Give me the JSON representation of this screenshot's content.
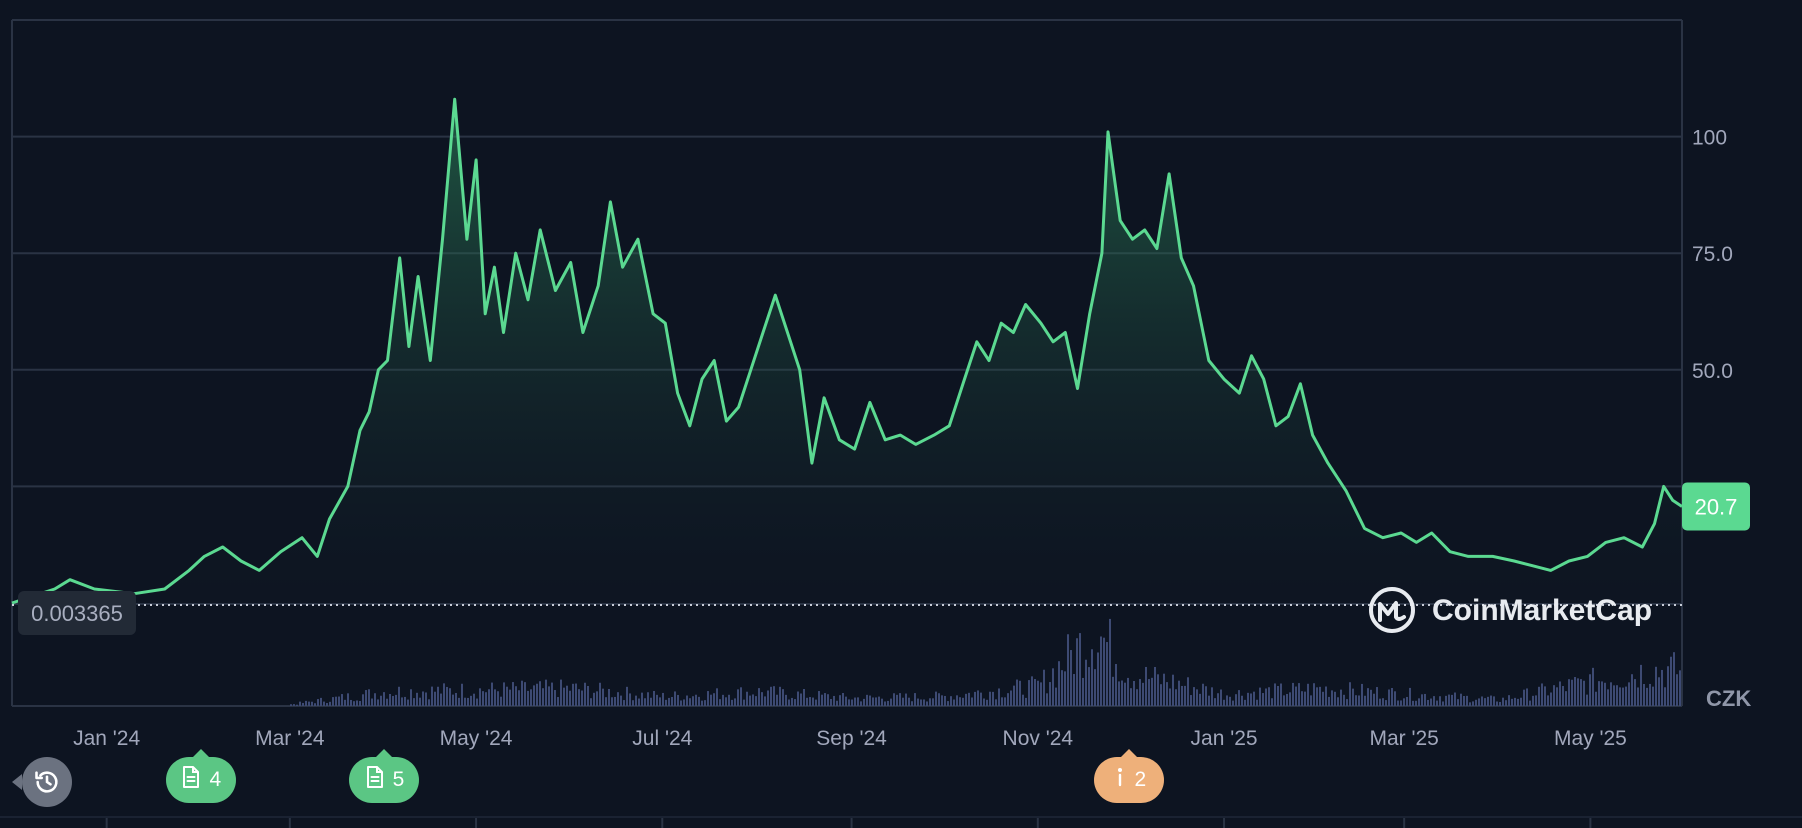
{
  "chart_data": {
    "type": "area",
    "x_range": [
      "2023-12-01",
      "2025-05-31"
    ],
    "ylim": [
      0,
      125
    ],
    "y_ticks": [
      {
        "value": 100,
        "label": "100"
      },
      {
        "value": 75,
        "label": "75.0"
      },
      {
        "value": 50,
        "label": "50.0"
      },
      {
        "value": 25,
        "label": ""
      }
    ],
    "x_ticks": [
      {
        "date": "2024-01-01",
        "label": "Jan '24"
      },
      {
        "date": "2024-03-01",
        "label": "Mar '24"
      },
      {
        "date": "2024-05-01",
        "label": "May '24"
      },
      {
        "date": "2024-07-01",
        "label": "Jul '24"
      },
      {
        "date": "2024-09-01",
        "label": "Sep '24"
      },
      {
        "date": "2024-11-01",
        "label": "Nov '24"
      },
      {
        "date": "2025-01-01",
        "label": "Jan '25"
      },
      {
        "date": "2025-03-01",
        "label": "Mar '25"
      },
      {
        "date": "2025-05-01",
        "label": "May '25"
      }
    ],
    "series": [
      {
        "line_color": "#5bd991",
        "points": [
          [
            "2023-12-01",
            0.003365
          ],
          [
            "2023-12-15",
            3
          ],
          [
            "2023-12-20",
            5
          ],
          [
            "2023-12-28",
            3
          ],
          [
            "2024-01-10",
            2
          ],
          [
            "2024-01-20",
            3
          ],
          [
            "2024-01-28",
            7
          ],
          [
            "2024-02-02",
            10
          ],
          [
            "2024-02-08",
            12
          ],
          [
            "2024-02-14",
            9
          ],
          [
            "2024-02-20",
            7
          ],
          [
            "2024-02-27",
            11
          ],
          [
            "2024-03-05",
            14
          ],
          [
            "2024-03-10",
            10
          ],
          [
            "2024-03-14",
            18
          ],
          [
            "2024-03-20",
            25
          ],
          [
            "2024-03-24",
            37
          ],
          [
            "2024-03-27",
            41
          ],
          [
            "2024-03-30",
            50
          ],
          [
            "2024-04-02",
            52
          ],
          [
            "2024-04-06",
            74
          ],
          [
            "2024-04-09",
            55
          ],
          [
            "2024-04-12",
            70
          ],
          [
            "2024-04-16",
            52
          ],
          [
            "2024-04-20",
            78
          ],
          [
            "2024-04-24",
            108
          ],
          [
            "2024-04-28",
            78
          ],
          [
            "2024-05-01",
            95
          ],
          [
            "2024-05-04",
            62
          ],
          [
            "2024-05-07",
            72
          ],
          [
            "2024-05-10",
            58
          ],
          [
            "2024-05-14",
            75
          ],
          [
            "2024-05-18",
            65
          ],
          [
            "2024-05-22",
            80
          ],
          [
            "2024-05-27",
            67
          ],
          [
            "2024-06-01",
            73
          ],
          [
            "2024-06-05",
            58
          ],
          [
            "2024-06-10",
            68
          ],
          [
            "2024-06-14",
            86
          ],
          [
            "2024-06-18",
            72
          ],
          [
            "2024-06-23",
            78
          ],
          [
            "2024-06-28",
            62
          ],
          [
            "2024-07-02",
            60
          ],
          [
            "2024-07-06",
            45
          ],
          [
            "2024-07-10",
            38
          ],
          [
            "2024-07-14",
            48
          ],
          [
            "2024-07-18",
            52
          ],
          [
            "2024-07-22",
            39
          ],
          [
            "2024-07-26",
            42
          ],
          [
            "2024-07-30",
            50
          ],
          [
            "2024-08-03",
            58
          ],
          [
            "2024-08-07",
            66
          ],
          [
            "2024-08-11",
            58
          ],
          [
            "2024-08-15",
            50
          ],
          [
            "2024-08-19",
            30
          ],
          [
            "2024-08-23",
            44
          ],
          [
            "2024-08-28",
            35
          ],
          [
            "2024-09-02",
            33
          ],
          [
            "2024-09-07",
            43
          ],
          [
            "2024-09-12",
            35
          ],
          [
            "2024-09-17",
            36
          ],
          [
            "2024-09-22",
            34
          ],
          [
            "2024-09-28",
            36
          ],
          [
            "2024-10-03",
            38
          ],
          [
            "2024-10-08",
            48
          ],
          [
            "2024-10-12",
            56
          ],
          [
            "2024-10-16",
            52
          ],
          [
            "2024-10-20",
            60
          ],
          [
            "2024-10-24",
            58
          ],
          [
            "2024-10-28",
            64
          ],
          [
            "2024-11-02",
            60
          ],
          [
            "2024-11-06",
            56
          ],
          [
            "2024-11-10",
            58
          ],
          [
            "2024-11-14",
            46
          ],
          [
            "2024-11-18",
            62
          ],
          [
            "2024-11-22",
            75
          ],
          [
            "2024-11-24",
            101
          ],
          [
            "2024-11-28",
            82
          ],
          [
            "2024-12-02",
            78
          ],
          [
            "2024-12-06",
            80
          ],
          [
            "2024-12-10",
            76
          ],
          [
            "2024-12-14",
            92
          ],
          [
            "2024-12-18",
            74
          ],
          [
            "2024-12-22",
            68
          ],
          [
            "2024-12-27",
            52
          ],
          [
            "2025-01-01",
            48
          ],
          [
            "2025-01-06",
            45
          ],
          [
            "2025-01-10",
            53
          ],
          [
            "2025-01-14",
            48
          ],
          [
            "2025-01-18",
            38
          ],
          [
            "2025-01-22",
            40
          ],
          [
            "2025-01-26",
            47
          ],
          [
            "2025-01-30",
            36
          ],
          [
            "2025-02-04",
            30
          ],
          [
            "2025-02-10",
            24
          ],
          [
            "2025-02-16",
            16
          ],
          [
            "2025-02-22",
            14
          ],
          [
            "2025-02-28",
            15
          ],
          [
            "2025-03-05",
            13
          ],
          [
            "2025-03-10",
            15
          ],
          [
            "2025-03-16",
            11
          ],
          [
            "2025-03-22",
            10
          ],
          [
            "2025-03-30",
            10
          ],
          [
            "2025-04-06",
            9
          ],
          [
            "2025-04-12",
            8
          ],
          [
            "2025-04-18",
            7
          ],
          [
            "2025-04-24",
            9
          ],
          [
            "2025-04-30",
            10
          ],
          [
            "2025-05-06",
            13
          ],
          [
            "2025-05-12",
            14
          ],
          [
            "2025-05-18",
            12
          ],
          [
            "2025-05-22",
            17
          ],
          [
            "2025-05-25",
            25
          ],
          [
            "2025-05-28",
            22
          ],
          [
            "2025-05-31",
            20.7
          ]
        ]
      }
    ],
    "reference_line": {
      "value": 0.003365,
      "label": "0.003365"
    },
    "current_value": {
      "value": 20.7,
      "label": "20.7",
      "color": "#5bd991"
    },
    "volume": {
      "color": "#3d4a73",
      "points": [
        [
          "2024-03-01",
          2
        ],
        [
          "2024-04-01",
          18
        ],
        [
          "2024-05-01",
          20
        ],
        [
          "2024-06-01",
          22
        ],
        [
          "2024-07-01",
          12
        ],
        [
          "2024-08-01",
          18
        ],
        [
          "2024-09-01",
          10
        ],
        [
          "2024-10-01",
          12
        ],
        [
          "2024-11-01",
          25
        ],
        [
          "2024-11-20",
          95
        ],
        [
          "2024-12-01",
          40
        ],
        [
          "2024-12-15",
          30
        ],
        [
          "2025-01-01",
          15
        ],
        [
          "2025-02-01",
          22
        ],
        [
          "2025-03-01",
          15
        ],
        [
          "2025-04-01",
          8
        ],
        [
          "2025-05-20",
          45
        ]
      ]
    },
    "currency_label": "CZK"
  },
  "watermark": {
    "text": "CoinMarketCap"
  },
  "events": [
    {
      "date": "2024-02-01",
      "icon": "document-icon",
      "count": "4",
      "color": "#5bc684"
    },
    {
      "date": "2024-04-01",
      "icon": "document-icon",
      "count": "5",
      "color": "#5bc684"
    },
    {
      "date": "2024-12-01",
      "icon": "info-icon",
      "count": "2",
      "color": "#eeb07a"
    }
  ],
  "controls": {
    "history_icon": "history-icon"
  }
}
